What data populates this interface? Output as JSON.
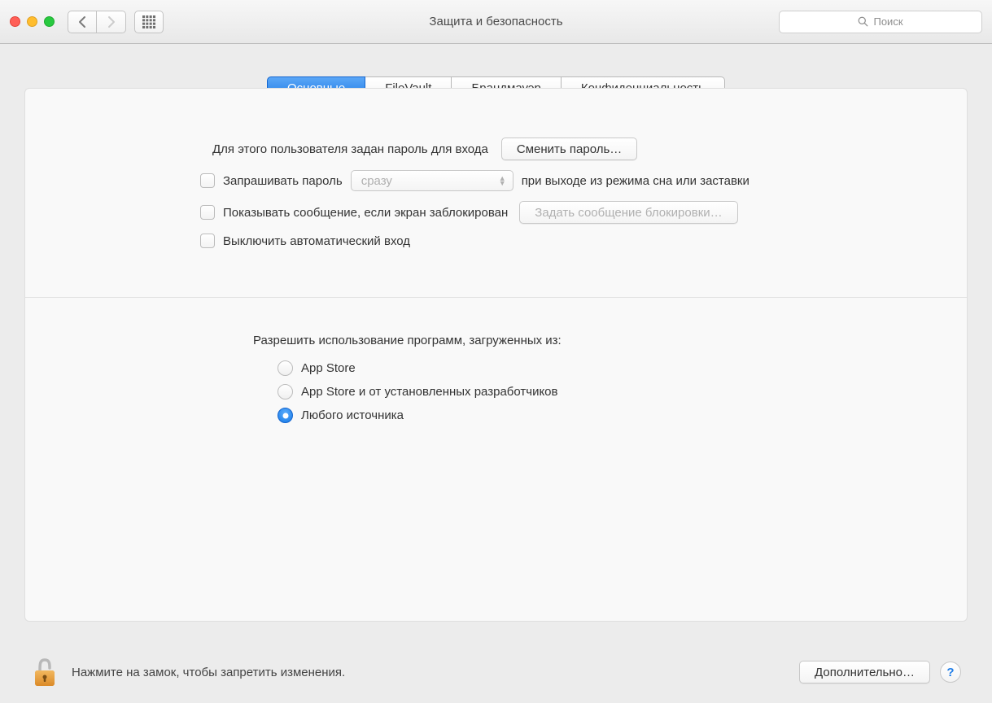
{
  "window": {
    "title": "Защита и безопасность"
  },
  "search": {
    "placeholder": "Поиск"
  },
  "tabs": [
    {
      "label": "Основные",
      "active": true
    },
    {
      "label": "FileVault",
      "active": false
    },
    {
      "label": "Брандмауэр",
      "active": false
    },
    {
      "label": "Конфиденциальность",
      "active": false
    }
  ],
  "password": {
    "text": "Для этого пользователя задан пароль для входа",
    "change_button": "Сменить пароль…"
  },
  "checkboxes": {
    "require_password_prefix": "Запрашивать пароль",
    "require_password_select": "сразу",
    "require_password_suffix": "при выходе из режима сна или заставки",
    "show_message": "Показывать сообщение, если экран заблокирован",
    "set_lock_message_button": "Задать сообщение блокировки…",
    "disable_autologin": "Выключить автоматический вход"
  },
  "gatekeeper": {
    "title": "Разрешить использование программ, загруженных из:",
    "options": [
      {
        "label": "App Store",
        "checked": false
      },
      {
        "label": "App Store и от установленных разработчиков",
        "checked": false
      },
      {
        "label": "Любого источника",
        "checked": true
      }
    ]
  },
  "footer": {
    "lock_text": "Нажмите на замок, чтобы запретить изменения.",
    "advanced_button": "Дополнительно…",
    "help": "?"
  }
}
